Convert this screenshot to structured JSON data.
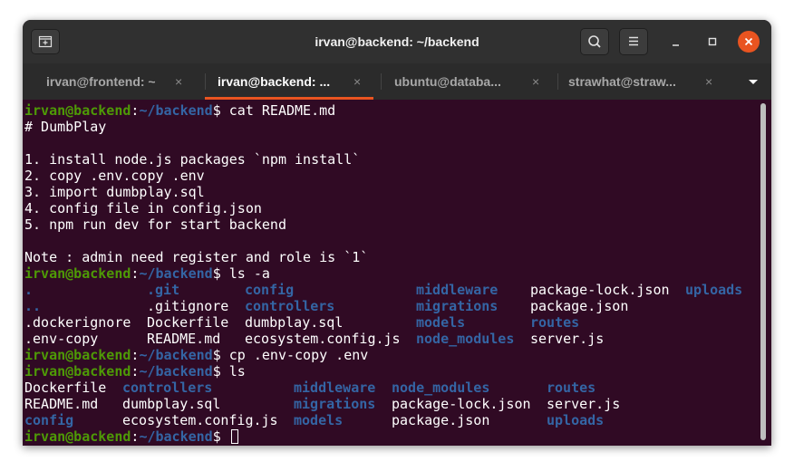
{
  "window": {
    "title": "irvan@backend: ~/backend",
    "colors": {
      "accent": "#e95420",
      "background": "#300a24",
      "prompt_user": "#4e9a06",
      "prompt_path": "#3465a4"
    }
  },
  "controls": {
    "new_tab_icon": "new-tab-icon",
    "search_icon": "search-icon",
    "menu_icon": "hamburger-menu-icon",
    "minimize_icon": "minimize-icon",
    "maximize_icon": "maximize-icon",
    "close_icon": "close-icon"
  },
  "tabs": [
    {
      "label": "irvan@frontend: ~",
      "close": "×",
      "active": false
    },
    {
      "label": "irvan@backend: ...",
      "close": "×",
      "active": true
    },
    {
      "label": "ubuntu@databa...",
      "close": "×",
      "active": false
    },
    {
      "label": "strawhat@straw...",
      "close": "×",
      "active": false
    }
  ],
  "terminal": {
    "prompt_user": "irvan@backend",
    "prompt_colon": ":",
    "prompt_path": "~/backend",
    "prompt_symbol": "$ ",
    "cmd1": "cat README.md",
    "readme": [
      "# DumbPlay",
      "",
      "1. install node.js packages `npm install`",
      "2. copy .env.copy .env",
      "3. import dumbplay.sql",
      "4. config file in config.json",
      "5. npm run dev for start backend",
      "",
      "Note : admin need register and role is `1`"
    ],
    "cmd2": "ls -a",
    "lsa_rows": [
      [
        ".",
        ".git",
        "config",
        "middleware",
        "package-lock.json",
        "uploads"
      ],
      [
        "..",
        ".gitignore",
        "controllers",
        "migrations",
        "package.json",
        ""
      ],
      [
        ".dockerignore",
        "Dockerfile",
        "dumbplay.sql",
        "models",
        "routes",
        ""
      ],
      [
        ".env-copy",
        "README.md",
        "ecosystem.config.js",
        "node_modules",
        "server.js",
        ""
      ]
    ],
    "cmd3": "cp .env-copy .env",
    "cmd4": "ls",
    "ls_rows": [
      [
        "Dockerfile",
        "controllers",
        "middleware",
        "node_modules",
        "routes"
      ],
      [
        "README.md",
        "dumbplay.sql",
        "migrations",
        "package-lock.json",
        "server.js"
      ],
      [
        "config",
        "ecosystem.config.js",
        "models",
        "package.json",
        "uploads"
      ]
    ]
  }
}
